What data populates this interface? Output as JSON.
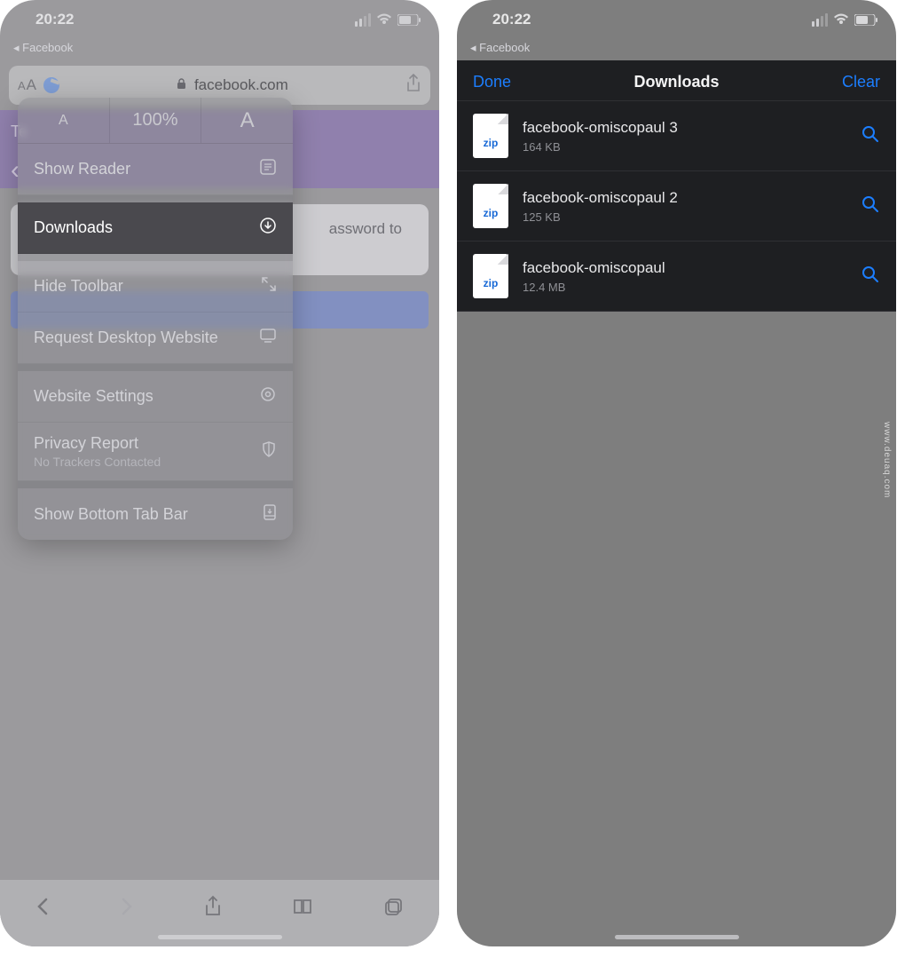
{
  "status": {
    "time": "20:22",
    "breadcrumb_prefix": "◂",
    "breadcrumb_app": "Facebook"
  },
  "left": {
    "address": {
      "aa_label": "AA",
      "url": "facebook.com",
      "lock": "🔒"
    },
    "purple": {
      "back": "‹",
      "label": "Te"
    },
    "card_text": "assword to",
    "aa_menu": {
      "zoom_small": "A",
      "zoom_value": "100%",
      "zoom_large": "A",
      "items": [
        {
          "label": "Show Reader",
          "icon": "reader-icon"
        },
        {
          "label": "Downloads",
          "icon": "download-icon",
          "highlighted": true
        },
        {
          "label": "Hide Toolbar",
          "icon": "expand-icon"
        },
        {
          "label": "Request Desktop Website",
          "icon": "monitor-icon"
        },
        {
          "label": "Website Settings",
          "icon": "gear-icon"
        },
        {
          "label": "Privacy Report",
          "sub": "No Trackers Contacted",
          "icon": "shield-icon"
        },
        {
          "label": "Show Bottom Tab Bar",
          "icon": "dock-icon"
        }
      ]
    }
  },
  "right": {
    "downloads": {
      "done": "Done",
      "title": "Downloads",
      "clear": "Clear",
      "zip_label": "zip",
      "items": [
        {
          "name": "facebook-omiscopaul 3",
          "size": "164 KB"
        },
        {
          "name": "facebook-omiscopaul 2",
          "size": "125 KB"
        },
        {
          "name": "facebook-omiscopaul",
          "size": "12.4 MB"
        }
      ]
    }
  },
  "watermark": "www.deuaq.com"
}
